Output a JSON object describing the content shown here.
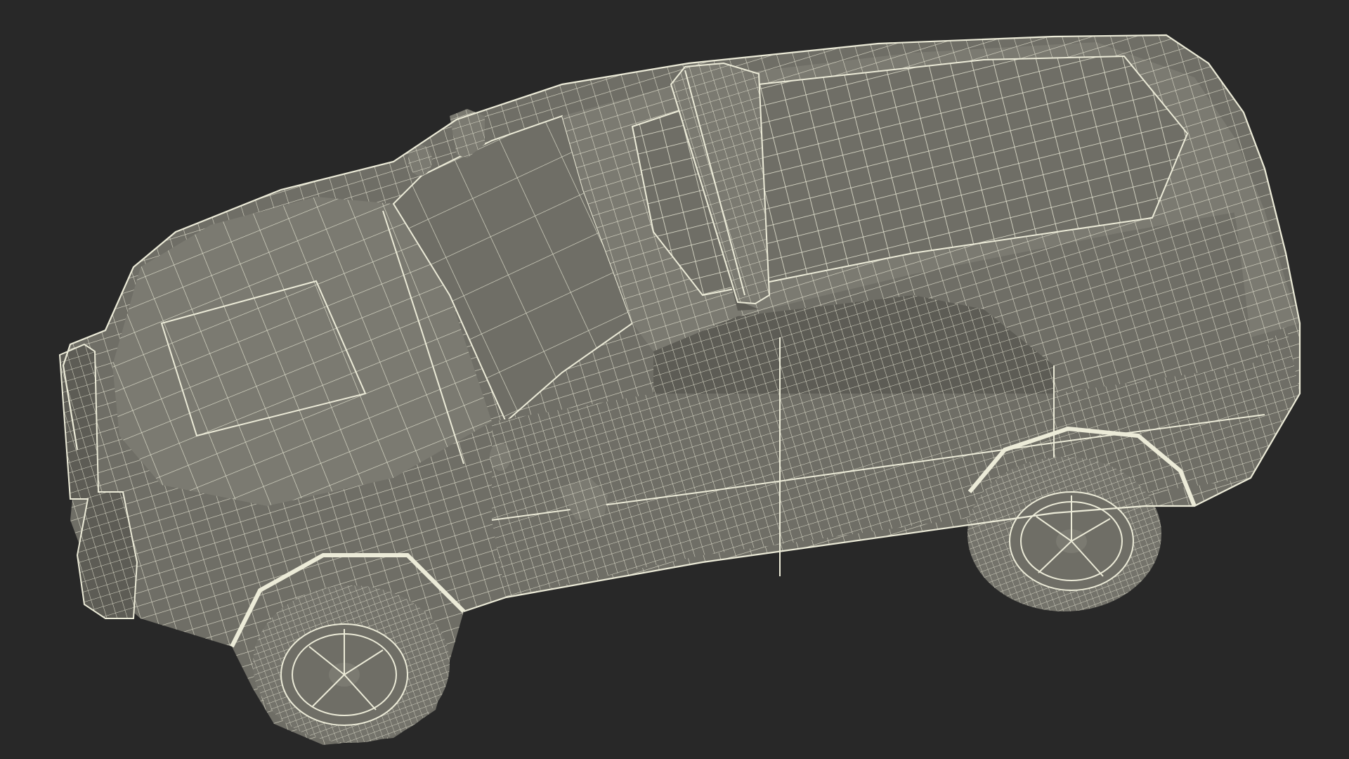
{
  "scene": {
    "subject": "police-suv-wireframe-render",
    "background_color": "#282828",
    "body_fill": "#6f6e66",
    "body_fill_light": "#7b7a71",
    "body_fill_dark": "#5d5c55",
    "wire_color": "#ecebd8",
    "tire_fill": "#74736b"
  }
}
